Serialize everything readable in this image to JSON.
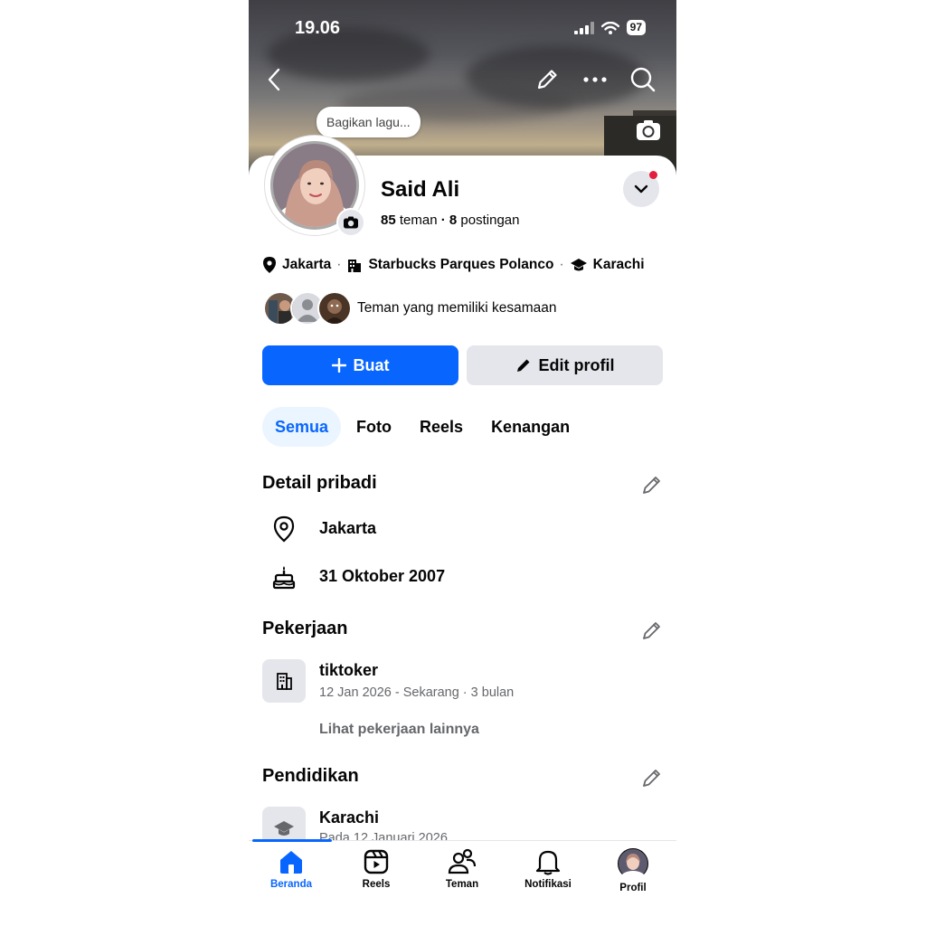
{
  "status_bar": {
    "time": "19.06",
    "battery": "97"
  },
  "cover": {
    "share_song_bubble": "Bagikan lagu..."
  },
  "profile": {
    "name": "Said Ali",
    "friends_count": "85",
    "friends_label": "teman",
    "posts_count": "8",
    "posts_label": "postingan"
  },
  "intro": {
    "location": "Jakarta",
    "workplace": "Starbucks Parques Polanco",
    "school": "Karachi"
  },
  "mutual": {
    "label": "Teman yang memiliki kesamaan"
  },
  "actions": {
    "create_label": "Buat",
    "edit_label": "Edit profil"
  },
  "tabs": [
    {
      "label": "Semua",
      "active": true
    },
    {
      "label": "Foto",
      "active": false
    },
    {
      "label": "Reels",
      "active": false
    },
    {
      "label": "Kenangan",
      "active": false
    }
  ],
  "details": {
    "title": "Detail pribadi",
    "location": "Jakarta",
    "birthday": "31 Oktober 2007"
  },
  "work": {
    "title": "Pekerjaan",
    "job_title": "tiktoker",
    "job_period": "12 Jan 2026 - Sekarang · 3 bulan",
    "see_more": "Lihat pekerjaan lainnya"
  },
  "education": {
    "title": "Pendidikan",
    "school": "Karachi",
    "school_period": "Pada 12 Januari 2026"
  },
  "bottom_nav": [
    {
      "label": "Beranda",
      "icon": "home-icon",
      "active": true
    },
    {
      "label": "Reels",
      "icon": "reels-icon",
      "active": false
    },
    {
      "label": "Teman",
      "icon": "friends-icon",
      "active": false
    },
    {
      "label": "Notifikasi",
      "icon": "bell-icon",
      "active": false
    },
    {
      "label": "Profil",
      "icon": "avatar",
      "active": false
    }
  ],
  "colors": {
    "accent": "#0866ff",
    "notification_dot": "#e41e3f",
    "secondary_bg": "#e4e6eb",
    "muted_text": "#65676b"
  }
}
